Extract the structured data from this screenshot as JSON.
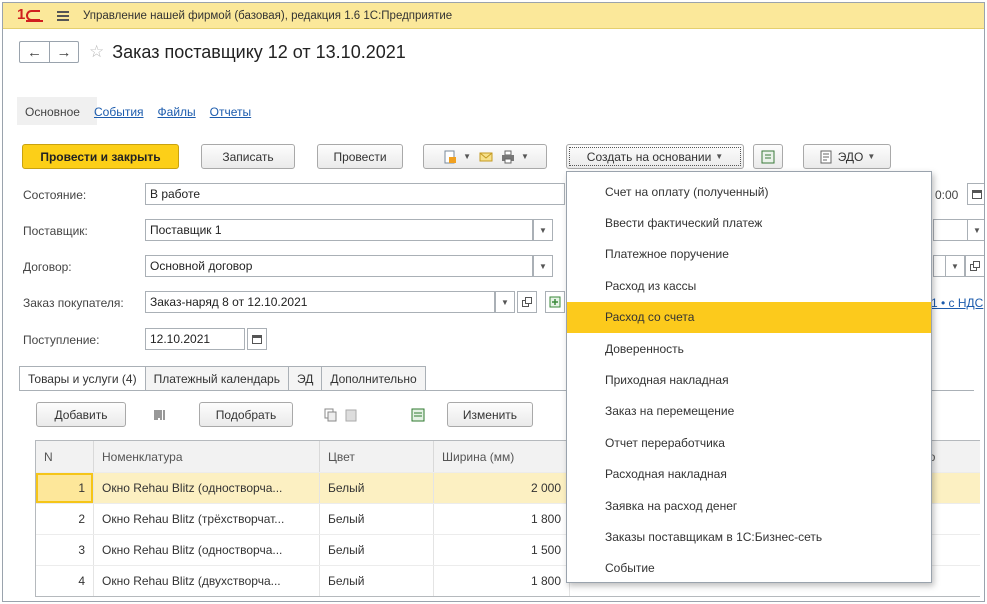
{
  "app": {
    "title": "Управление нашей фирмой (базовая), редакция 1.6 1С:Предприятие"
  },
  "nav": {
    "back": "←",
    "forward": "→",
    "star": "☆"
  },
  "document": {
    "title": "Заказ поставщику 12 от 13.10.2021"
  },
  "sections": {
    "main": "Основное",
    "events": "События",
    "files": "Файлы",
    "reports": "Отчеты"
  },
  "toolbar": {
    "post_close": "Провести и закрыть",
    "save": "Записать",
    "post": "Провести",
    "create_based": "Создать на основании",
    "edo": "ЭДО"
  },
  "form": {
    "status_label": "Состояние:",
    "status_value": "В работе",
    "supplier_label": "Поставщик:",
    "supplier_value": "Поставщик 1",
    "contract_label": "Договор:",
    "contract_value": "Основной договор",
    "customer_order_label": "Заказ покупателя:",
    "customer_order_value": "Заказ-наряд 8 от 12.10.2021",
    "receipt_label": "Поступление:",
    "receipt_value": "12.10.2021",
    "time_fragment": "0:00",
    "vat_link": "1 • с НДС"
  },
  "tabs": [
    "Товары и услуги (4)",
    "Платежный календарь",
    "ЭД",
    "Дополнительно"
  ],
  "table_toolbar": {
    "add": "Добавить",
    "pick": "Подобрать",
    "change": "Изменить"
  },
  "table": {
    "headers": {
      "n": "N",
      "nomenclature": "Номенклатура",
      "color": "Цвет",
      "width": "Ширина (мм)",
      "qty": "оличество"
    },
    "rows": [
      {
        "n": "1",
        "nomenclature": "Окно Rehau Blitz (одностворча...",
        "color": "Белый",
        "width": "2 000"
      },
      {
        "n": "2",
        "nomenclature": "Окно Rehau Blitz (трёхстворчат...",
        "color": "Белый",
        "width": "1 800"
      },
      {
        "n": "3",
        "nomenclature": "Окно Rehau Blitz (одностворча...",
        "color": "Белый",
        "width": "1 500"
      },
      {
        "n": "4",
        "nomenclature": "Окно Rehau Blitz (двухстворча...",
        "color": "Белый",
        "width": "1 800"
      }
    ]
  },
  "menu": {
    "items": [
      "Счет на оплату (полученный)",
      "Ввести фактический платеж",
      "Платежное поручение",
      "Расход из кассы",
      "Расход со счета",
      "Доверенность",
      "Приходная накладная",
      "Заказ на перемещение",
      "Отчет переработчика",
      "Расходная накладная",
      "Заявка на расход денег",
      "Заказы поставщикам в 1С:Бизнес-сеть",
      "Событие"
    ],
    "highlighted": "Расход со счета"
  },
  "colors": {
    "titlebar": "#fbe89a",
    "primary": "#fccf18",
    "highlight": "#fcca1c",
    "link": "#1b5bad",
    "selected_row": "#fcf0c2"
  }
}
